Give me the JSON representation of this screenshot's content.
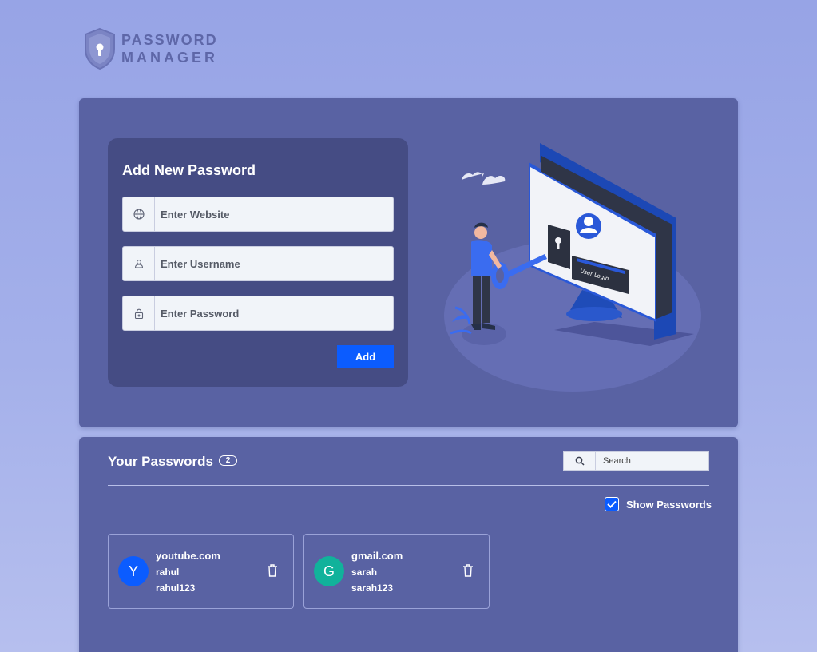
{
  "logo": {
    "line1": "PASSWORD",
    "line2": "MANAGER"
  },
  "form": {
    "title": "Add New Password",
    "website_placeholder": "Enter Website",
    "username_placeholder": "Enter Username",
    "password_placeholder": "Enter Password",
    "add_label": "Add"
  },
  "illustration": {
    "screen_text": "User Login"
  },
  "list": {
    "title": "Your Passwords",
    "count": "2",
    "search_placeholder": "Search",
    "show_passwords_label": "Show Passwords",
    "show_passwords_checked": true,
    "items": [
      {
        "initial": "Y",
        "website": "youtube.com",
        "username": "rahul",
        "password": "rahul123",
        "avatar_color": "#0b5cff"
      },
      {
        "initial": "G",
        "website": "gmail.com",
        "username": "sarah",
        "password": "sarah123",
        "avatar_color": "#11b29b"
      }
    ]
  },
  "colors": {
    "accent": "#0b5cff",
    "card": "#5962a3",
    "panel": "#454c84",
    "background": "#9ba7e8"
  },
  "icons": [
    "shield-keyhole-icon",
    "globe-icon",
    "user-icon",
    "lock-icon",
    "search-icon",
    "checkmark-icon",
    "trash-icon"
  ]
}
